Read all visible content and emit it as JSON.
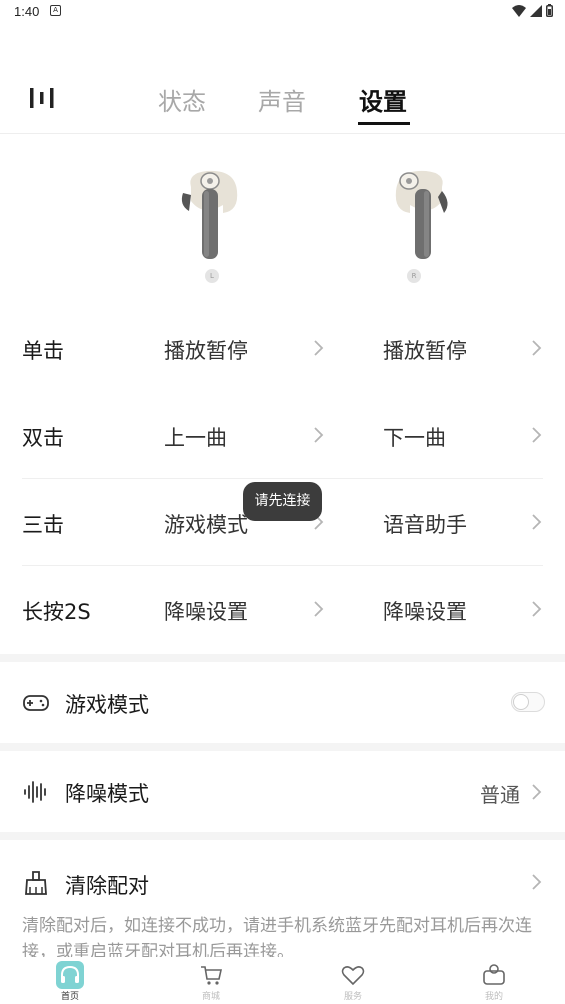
{
  "status_bar": {
    "time": "1:40",
    "notif": "A"
  },
  "header": {
    "tabs": [
      {
        "label": "状态"
      },
      {
        "label": "声音"
      },
      {
        "label": "设置"
      }
    ]
  },
  "earbuds": {
    "left_tag": "L",
    "right_tag": "R"
  },
  "gestures": [
    {
      "label": "单击",
      "left": "播放暂停",
      "right": "播放暂停"
    },
    {
      "label": "双击",
      "left": "上一曲",
      "right": "下一曲"
    },
    {
      "label": "三击",
      "left": "游戏模式",
      "right": "语音助手"
    },
    {
      "label": "长按2S",
      "left": "降噪设置",
      "right": "降噪设置"
    }
  ],
  "toast": "请先连接",
  "settings": {
    "game_mode": {
      "label": "游戏模式",
      "enabled": false
    },
    "anc_mode": {
      "label": "降噪模式",
      "value": "普通"
    },
    "clear_pairing": {
      "label": "清除配对",
      "description": "清除配对后，如连接不成功，请进手机系统蓝牙先配对耳机后再次连接，或重启蓝牙配对耳机后再连接。"
    }
  },
  "bottom_nav": [
    {
      "label": "首页",
      "active": true
    },
    {
      "label": "商城",
      "active": false
    },
    {
      "label": "服务",
      "active": false
    },
    {
      "label": "我的",
      "active": false
    }
  ],
  "colors": {
    "accent": "#7fd3d3",
    "text_primary": "#1a1a1a",
    "text_muted": "#a8a8a8"
  }
}
